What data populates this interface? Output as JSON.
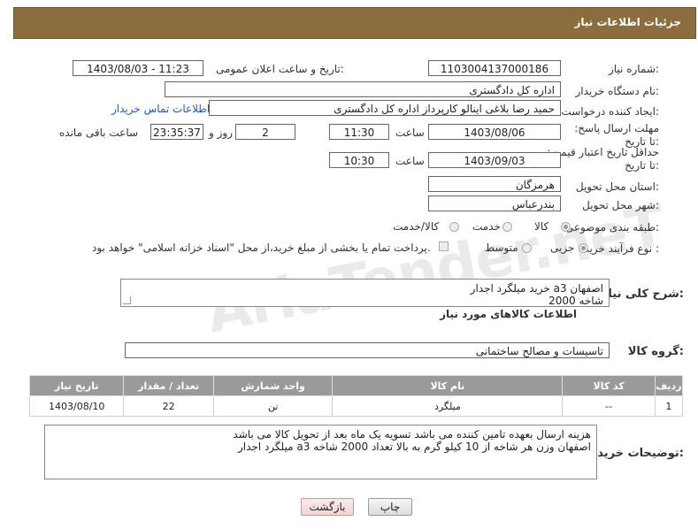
{
  "header": {
    "title": "جزئیات اطلاعات نیاز"
  },
  "fields": {
    "need_number_label": "شماره نیاز:",
    "need_number": "1103004137000186",
    "announce_label": "تاریخ و ساعت اعلان عمومی:",
    "announce_value": "1403/08/03 - 11:23",
    "buyer_org_label": "نام دستگاه خریدار:",
    "buyer_org": "اداره کل دادگستری",
    "creator_label": "ایجاد کننده درخواست:",
    "creator": "حمید رضا  بلاغی اینالو کارپرداز اداره کل دادگستری",
    "contact_link": "اطلاعات تماس خریدار",
    "deadline_label": "مهلت ارسال پاسخ: تا تاریخ:",
    "deadline_date": "1403/08/06",
    "time_label": "ساعت",
    "deadline_time": "11:30",
    "days_value": "2",
    "days_label": "روز و",
    "remaining_time": "23:35:37",
    "remaining_label": "ساعت باقی مانده",
    "min_price_label": "حداقل تاریخ اعتبار قیمت: تا تاریخ:",
    "min_price_date": "1403/09/03",
    "min_price_time": "10:30",
    "province_label": "استان محل تحویل:",
    "province": "هرمزگان",
    "city_label": "شهر محل تحویل:",
    "city": "بندرعباس",
    "category_label": "طبقه بندی موضوعی:",
    "category_options": [
      "کالا",
      "خدمت",
      "کالا/خدمت"
    ],
    "category_selected": "کالا",
    "process_label": "نوع فرآیند خرید :",
    "process_options": [
      "جزیی",
      "متوسط"
    ],
    "process_selected": "جزیی",
    "payment_note": "پرداخت تمام یا بخشی از مبلغ خرید،از محل \"اسناد خزانه اسلامی\" خواهد بود."
  },
  "description": {
    "label": "شرح کلی نیاز:",
    "line1": "خرید میلگرد اجدار a3 اصفهان",
    "line2": "2000 شاخه"
  },
  "goods": {
    "section_title": "اطلاعات کالاهای مورد نیاز",
    "group_label": "گروه کالا:",
    "group_value": "تاسیسات و مصالح ساختمانی",
    "columns": [
      "ردیف",
      "کد کالا",
      "نام کالا",
      "واحد شمارش",
      "تعداد / مقدار",
      "تاریخ نیاز"
    ],
    "rows": [
      {
        "row": "1",
        "code": "--",
        "name": "میلگرد",
        "unit": "تن",
        "qty": "22",
        "date": "1403/08/10"
      }
    ]
  },
  "buyer_notes": {
    "label": "توضیحات خریدار:",
    "line1": "هزینه ارسال بعهده تامین کننده می باشد تسویه یک ماه بعد از تحویل کالا می باشد",
    "line2": "میلگرد اجدار a3 اصفهان وزن هر شاخه از 10 کیلو گرم به بالا تعداد 2000 شاخه"
  },
  "buttons": {
    "print": "چاپ",
    "back": "بازگشت"
  },
  "watermark": "AriaTender.neT"
}
